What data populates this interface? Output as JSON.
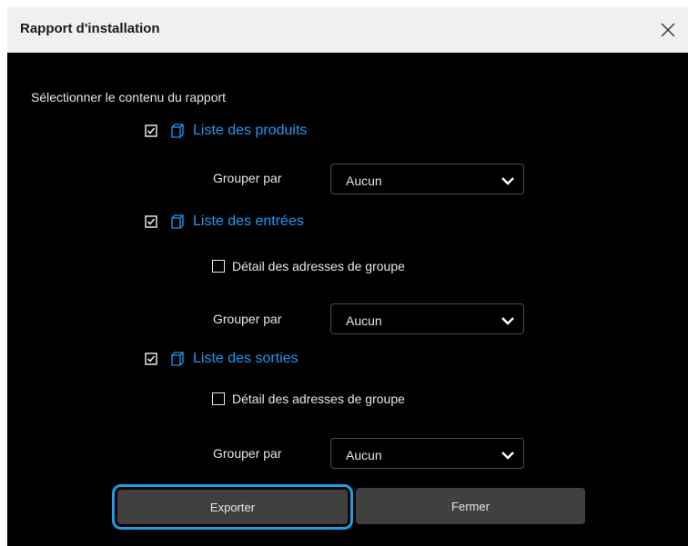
{
  "dialog": {
    "title": "Rapport d'installation",
    "close_icon": "close-icon"
  },
  "intro": "Sélectionner le contenu du rapport",
  "sections": [
    {
      "label": "Liste des produits",
      "checked": true,
      "icon": "cube-icon",
      "group_label": "Grouper par",
      "group_value": "Aucun"
    },
    {
      "label": "Liste des entrées",
      "checked": true,
      "icon": "cube-icon",
      "detail_label": "Détail des adresses de groupe",
      "detail_checked": false,
      "group_label": "Grouper par",
      "group_value": "Aucun"
    },
    {
      "label": "Liste des sorties",
      "checked": true,
      "icon": "cube-icon",
      "detail_label": "Détail des adresses de groupe",
      "detail_checked": false,
      "group_label": "Grouper par",
      "group_value": "Aucun"
    }
  ],
  "buttons": {
    "export_label": "Exporter",
    "close_label": "Fermer"
  },
  "colors": {
    "accent": "#2196f3",
    "focus_ring": "#1e9ce8",
    "background": "#000000",
    "titlebar": "#f0f0f0",
    "button": "#404040"
  }
}
